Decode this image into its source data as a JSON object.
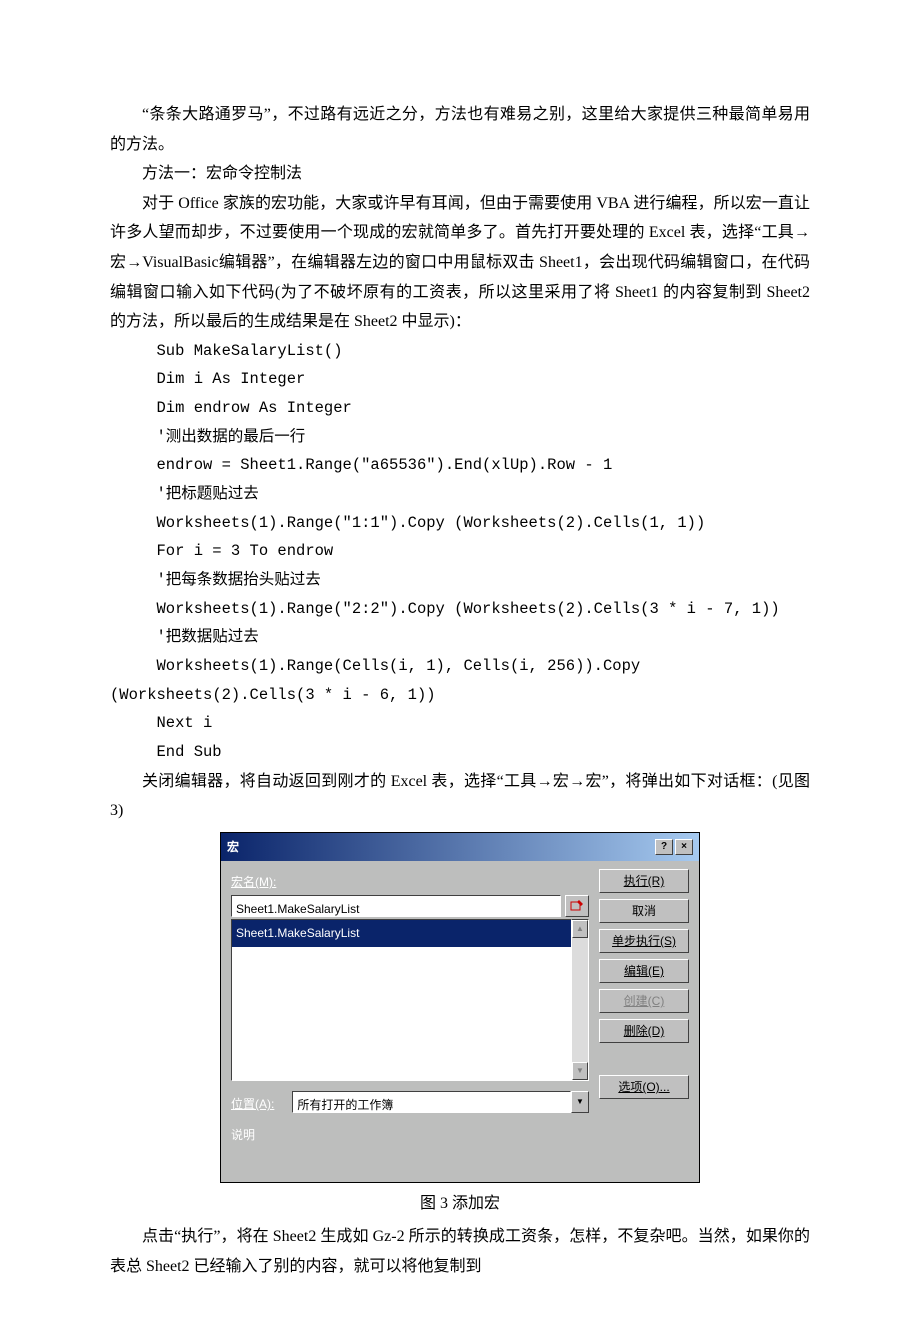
{
  "p1": "“条条大路通罗马”，不过路有远近之分，方法也有难易之别，这里给大家提供三种最简单易用的方法。",
  "p2": "方法一：宏命令控制法",
  "p3": "对于 Office 家族的宏功能，大家或许早有耳闻，但由于需要使用 VBA 进行编程，所以宏一直让许多人望而却步，不过要使用一个现成的宏就简单多了。首先打开要处理的 Excel 表，选择“工具→宏→VisualBasic编辑器”，在编辑器左边的窗口中用鼠标双击 Sheet1，会出现代码编辑窗口，在代码编辑窗口输入如下代码(为了不破坏原有的工资表，所以这里采用了将 Sheet1 的内容复制到 Sheet2 的方法，所以最后的生成结果是在 Sheet2 中显示)：",
  "code": {
    "l1": "Sub MakeSalaryList()",
    "l2": "Dim i As Integer",
    "l3": "Dim endrow As Integer",
    "l4": "'测出数据的最后一行",
    "l5": "endrow = Sheet1.Range(\"a65536\").End(xlUp).Row - 1",
    "l6": "'把标题贴过去",
    "l7": "Worksheets(1).Range(\"1:1\").Copy (Worksheets(2).Cells(1, 1))",
    "l8": "For i = 3 To endrow",
    "l9": "'把每条数据抬头贴过去",
    "l10": "Worksheets(1).Range(\"2:2\").Copy (Worksheets(2).Cells(3 * i - 7, 1))",
    "l11": "'把数据贴过去",
    "l12": "Worksheets(1).Range(Cells(i, 1), Cells(i, 256)).Copy",
    "l12b": "(Worksheets(2).Cells(3 * i - 6, 1))",
    "l13": "Next i",
    "l14": "End Sub"
  },
  "p4": "关闭编辑器，将自动返回到刚才的 Excel 表，选择“工具→宏→宏”，将弹出如下对话框：(见图 3)",
  "dialog": {
    "title": "宏",
    "help": "?",
    "close": "×",
    "name_label": "宏名(M):",
    "name_value": "Sheet1.MakeSalaryList",
    "list_item": "Sheet1.MakeSalaryList",
    "location_label": "位置(A):",
    "location_value": "所有打开的工作簿",
    "desc_label": "说明",
    "buttons": {
      "run": "执行(R)",
      "cancel": "取消",
      "step": "单步执行(S)",
      "edit": "编辑(E)",
      "create": "创建(C)",
      "delete": "删除(D)",
      "options": "选项(O)..."
    }
  },
  "caption": "图 3  添加宏",
  "p5": "点击“执行”，将在 Sheet2 生成如 Gz-2 所示的转换成工资条，怎样，不复杂吧。当然，如果你的表总 Sheet2 已经输入了别的内容，就可以将他复制到"
}
